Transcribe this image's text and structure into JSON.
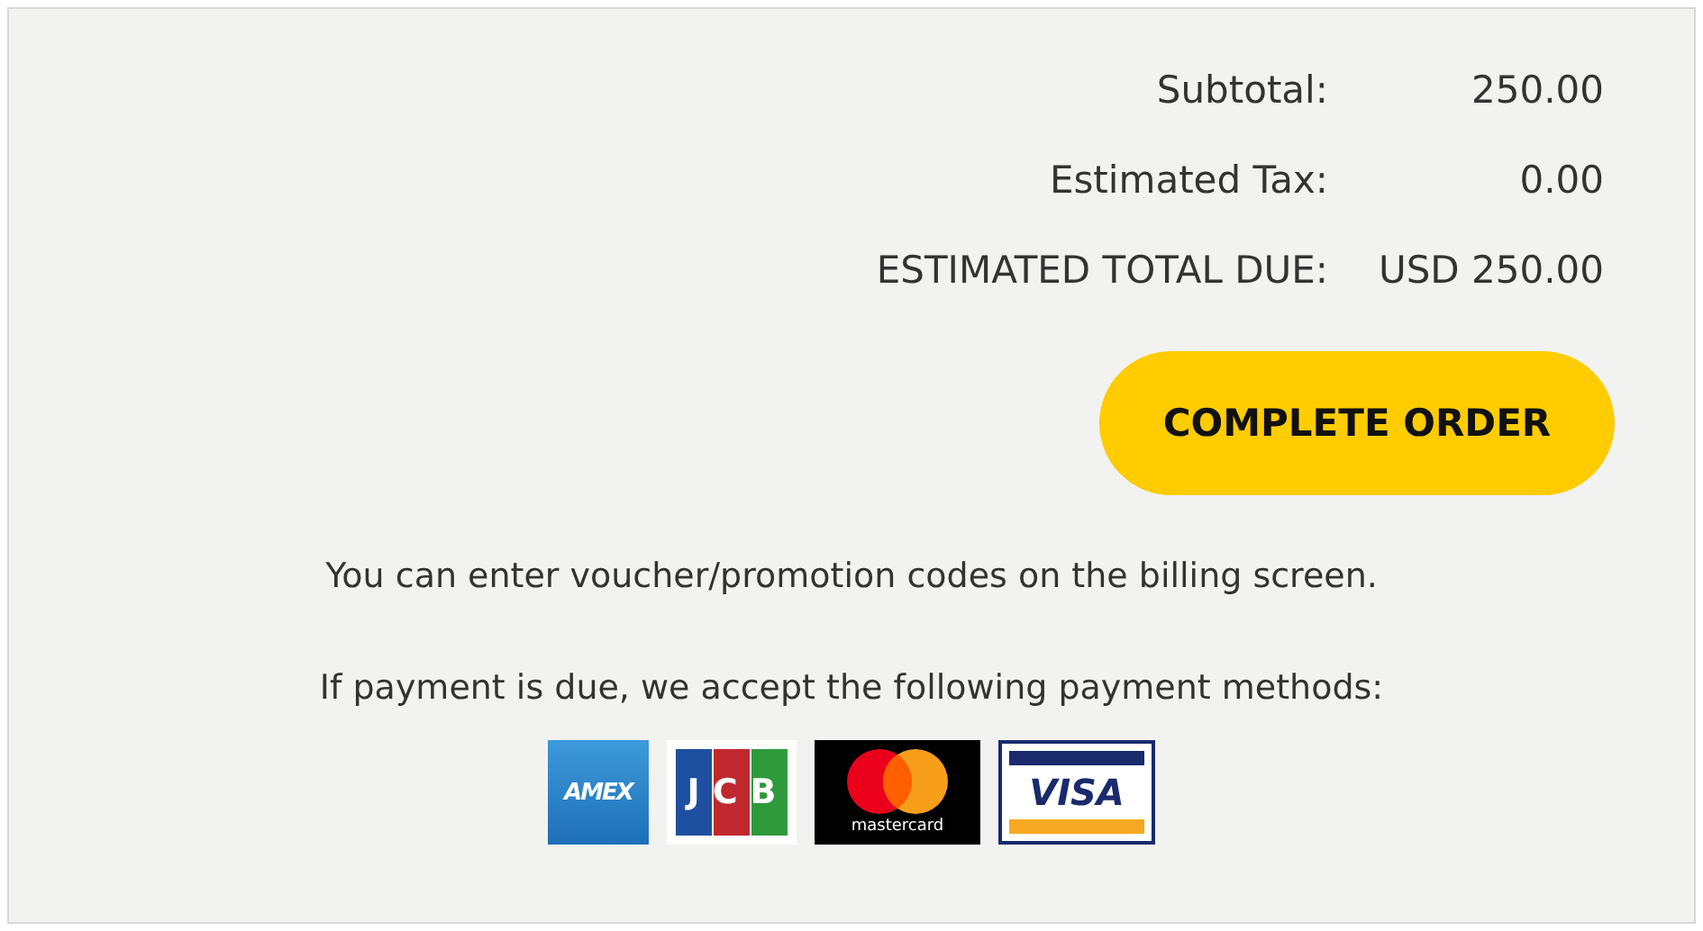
{
  "totals": [
    {
      "label": "Subtotal:",
      "value": "250.00"
    },
    {
      "label": "Estimated Tax:",
      "value": "0.00"
    },
    {
      "label": "ESTIMATED TOTAL DUE:",
      "value": "USD 250.00"
    }
  ],
  "button": {
    "label": "COMPLETE ORDER"
  },
  "notes": [
    "You can enter voucher/promotion codes on the billing screen.",
    "If payment is due, we accept the following payment methods:"
  ],
  "payment_methods": [
    {
      "kind": "amex",
      "label": "AMEX"
    },
    {
      "kind": "jcb",
      "label": "JCB"
    },
    {
      "kind": "mastercard",
      "label": "mastercard"
    },
    {
      "kind": "visa",
      "label": "VISA"
    }
  ]
}
